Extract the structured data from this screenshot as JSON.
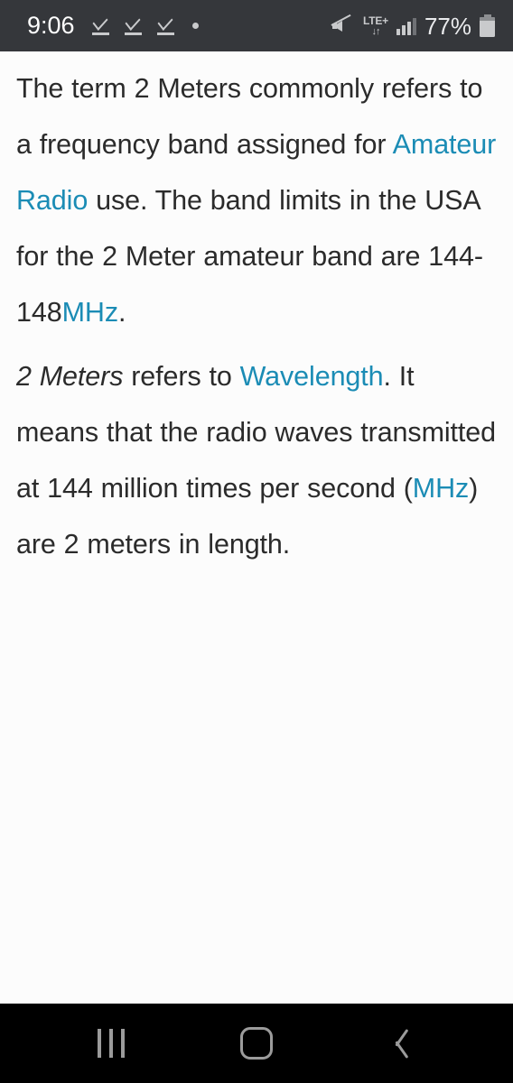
{
  "status_bar": {
    "time": "9:06",
    "notification_icons": [
      "task-complete-icon",
      "task-complete-icon",
      "task-complete-icon",
      "dot-icon"
    ],
    "mute_icon": "volume-mute-icon",
    "network_type": "LTE+",
    "network_arrows": "↓↑",
    "signal_icon": "signal-bars-icon",
    "battery_percent": "77%",
    "battery_icon": "battery-icon",
    "background_color": "#35373b",
    "foreground_color": "#c9cacc"
  },
  "article": {
    "link_color": "#1b8cb5",
    "text_color": "#2b2b2b",
    "background_color": "#fcfcfc",
    "paragraph_1": {
      "part_1": "The term 2 Meters commonly refers to a frequency band assigned for ",
      "link_1": "Amateur Radio",
      "part_2": " use. The band limits in the USA for the 2 Meter amateur band are 144-148",
      "link_2": "MHz",
      "part_3": "."
    },
    "paragraph_2": {
      "italic_1": "2 Meters",
      "part_1": " refers to ",
      "link_1": "Wavelength",
      "part_2": ". It means that the radio waves transmitted at 144 million times per second (",
      "link_2": "MHz",
      "part_3": ") are 2 meters in length."
    }
  },
  "nav_bar": {
    "background_color": "#000000",
    "icon_color": "#9b9b9b",
    "recents_label": "recents-icon",
    "home_label": "home-icon",
    "back_label": "back-icon"
  }
}
